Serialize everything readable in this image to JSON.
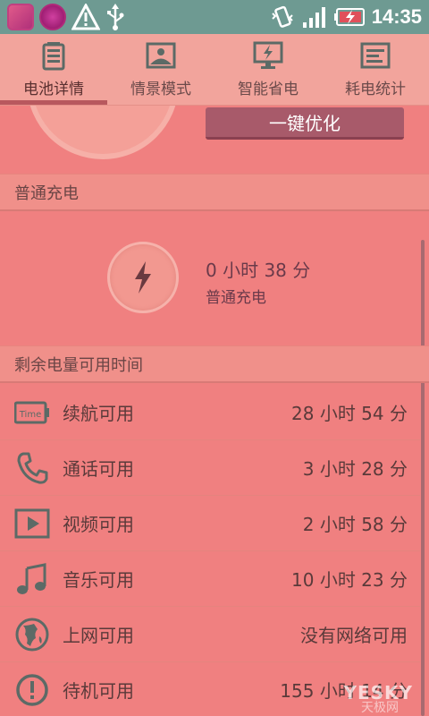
{
  "status_bar": {
    "time": "14:35"
  },
  "tabs": [
    {
      "label": "电池详情",
      "icon": "battery-icon",
      "active": true
    },
    {
      "label": "情景模式",
      "icon": "picture-icon",
      "active": false
    },
    {
      "label": "智能省电",
      "icon": "monitor-bolt-icon",
      "active": false
    },
    {
      "label": "耗电统计",
      "icon": "stats-icon",
      "active": false
    }
  ],
  "top": {
    "optimize_button": "一键优化"
  },
  "charging": {
    "section_title": "普通充电",
    "time_text": "0 小时 38 分",
    "mode_text": "普通充电"
  },
  "remaining": {
    "section_title": "剩余电量可用时间",
    "items": [
      {
        "label": "续航可用",
        "value": "28 小时 54 分",
        "icon": "time-battery-icon",
        "icon_text": "Time"
      },
      {
        "label": "通话可用",
        "value": "3 小时 28 分",
        "icon": "phone-icon"
      },
      {
        "label": "视频可用",
        "value": "2 小时 58 分",
        "icon": "video-play-icon"
      },
      {
        "label": "音乐可用",
        "value": "10 小时 23 分",
        "icon": "music-note-icon"
      },
      {
        "label": "上网可用",
        "value": "没有网络可用",
        "icon": "globe-icon"
      },
      {
        "label": "待机可用",
        "value": "155 小时 14 分",
        "icon": "standby-icon"
      }
    ]
  },
  "watermark": {
    "main": "YESKY",
    "sub": "天极网"
  },
  "colors": {
    "background": "#f08080",
    "status_bar": "#6e9a92",
    "tab_bar": "#f2a49c",
    "accent": "#b8585e",
    "button": "#a85a6a"
  }
}
